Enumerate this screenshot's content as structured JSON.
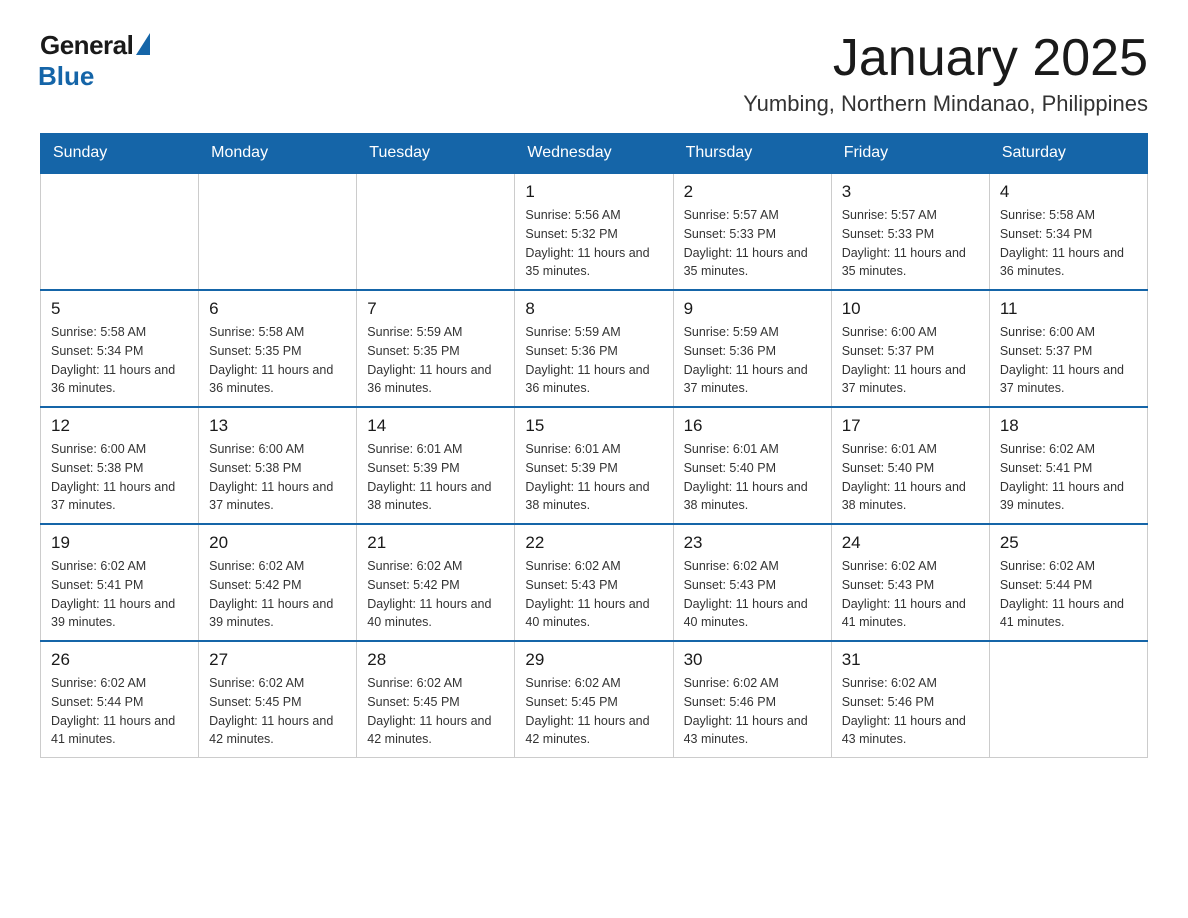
{
  "logo": {
    "general": "General",
    "blue": "Blue"
  },
  "header": {
    "month": "January 2025",
    "location": "Yumbing, Northern Mindanao, Philippines"
  },
  "days_of_week": [
    "Sunday",
    "Monday",
    "Tuesday",
    "Wednesday",
    "Thursday",
    "Friday",
    "Saturday"
  ],
  "weeks": [
    [
      {
        "day": "",
        "info": ""
      },
      {
        "day": "",
        "info": ""
      },
      {
        "day": "",
        "info": ""
      },
      {
        "day": "1",
        "info": "Sunrise: 5:56 AM\nSunset: 5:32 PM\nDaylight: 11 hours and 35 minutes."
      },
      {
        "day": "2",
        "info": "Sunrise: 5:57 AM\nSunset: 5:33 PM\nDaylight: 11 hours and 35 minutes."
      },
      {
        "day": "3",
        "info": "Sunrise: 5:57 AM\nSunset: 5:33 PM\nDaylight: 11 hours and 35 minutes."
      },
      {
        "day": "4",
        "info": "Sunrise: 5:58 AM\nSunset: 5:34 PM\nDaylight: 11 hours and 36 minutes."
      }
    ],
    [
      {
        "day": "5",
        "info": "Sunrise: 5:58 AM\nSunset: 5:34 PM\nDaylight: 11 hours and 36 minutes."
      },
      {
        "day": "6",
        "info": "Sunrise: 5:58 AM\nSunset: 5:35 PM\nDaylight: 11 hours and 36 minutes."
      },
      {
        "day": "7",
        "info": "Sunrise: 5:59 AM\nSunset: 5:35 PM\nDaylight: 11 hours and 36 minutes."
      },
      {
        "day": "8",
        "info": "Sunrise: 5:59 AM\nSunset: 5:36 PM\nDaylight: 11 hours and 36 minutes."
      },
      {
        "day": "9",
        "info": "Sunrise: 5:59 AM\nSunset: 5:36 PM\nDaylight: 11 hours and 37 minutes."
      },
      {
        "day": "10",
        "info": "Sunrise: 6:00 AM\nSunset: 5:37 PM\nDaylight: 11 hours and 37 minutes."
      },
      {
        "day": "11",
        "info": "Sunrise: 6:00 AM\nSunset: 5:37 PM\nDaylight: 11 hours and 37 minutes."
      }
    ],
    [
      {
        "day": "12",
        "info": "Sunrise: 6:00 AM\nSunset: 5:38 PM\nDaylight: 11 hours and 37 minutes."
      },
      {
        "day": "13",
        "info": "Sunrise: 6:00 AM\nSunset: 5:38 PM\nDaylight: 11 hours and 37 minutes."
      },
      {
        "day": "14",
        "info": "Sunrise: 6:01 AM\nSunset: 5:39 PM\nDaylight: 11 hours and 38 minutes."
      },
      {
        "day": "15",
        "info": "Sunrise: 6:01 AM\nSunset: 5:39 PM\nDaylight: 11 hours and 38 minutes."
      },
      {
        "day": "16",
        "info": "Sunrise: 6:01 AM\nSunset: 5:40 PM\nDaylight: 11 hours and 38 minutes."
      },
      {
        "day": "17",
        "info": "Sunrise: 6:01 AM\nSunset: 5:40 PM\nDaylight: 11 hours and 38 minutes."
      },
      {
        "day": "18",
        "info": "Sunrise: 6:02 AM\nSunset: 5:41 PM\nDaylight: 11 hours and 39 minutes."
      }
    ],
    [
      {
        "day": "19",
        "info": "Sunrise: 6:02 AM\nSunset: 5:41 PM\nDaylight: 11 hours and 39 minutes."
      },
      {
        "day": "20",
        "info": "Sunrise: 6:02 AM\nSunset: 5:42 PM\nDaylight: 11 hours and 39 minutes."
      },
      {
        "day": "21",
        "info": "Sunrise: 6:02 AM\nSunset: 5:42 PM\nDaylight: 11 hours and 40 minutes."
      },
      {
        "day": "22",
        "info": "Sunrise: 6:02 AM\nSunset: 5:43 PM\nDaylight: 11 hours and 40 minutes."
      },
      {
        "day": "23",
        "info": "Sunrise: 6:02 AM\nSunset: 5:43 PM\nDaylight: 11 hours and 40 minutes."
      },
      {
        "day": "24",
        "info": "Sunrise: 6:02 AM\nSunset: 5:43 PM\nDaylight: 11 hours and 41 minutes."
      },
      {
        "day": "25",
        "info": "Sunrise: 6:02 AM\nSunset: 5:44 PM\nDaylight: 11 hours and 41 minutes."
      }
    ],
    [
      {
        "day": "26",
        "info": "Sunrise: 6:02 AM\nSunset: 5:44 PM\nDaylight: 11 hours and 41 minutes."
      },
      {
        "day": "27",
        "info": "Sunrise: 6:02 AM\nSunset: 5:45 PM\nDaylight: 11 hours and 42 minutes."
      },
      {
        "day": "28",
        "info": "Sunrise: 6:02 AM\nSunset: 5:45 PM\nDaylight: 11 hours and 42 minutes."
      },
      {
        "day": "29",
        "info": "Sunrise: 6:02 AM\nSunset: 5:45 PM\nDaylight: 11 hours and 42 minutes."
      },
      {
        "day": "30",
        "info": "Sunrise: 6:02 AM\nSunset: 5:46 PM\nDaylight: 11 hours and 43 minutes."
      },
      {
        "day": "31",
        "info": "Sunrise: 6:02 AM\nSunset: 5:46 PM\nDaylight: 11 hours and 43 minutes."
      },
      {
        "day": "",
        "info": ""
      }
    ]
  ]
}
